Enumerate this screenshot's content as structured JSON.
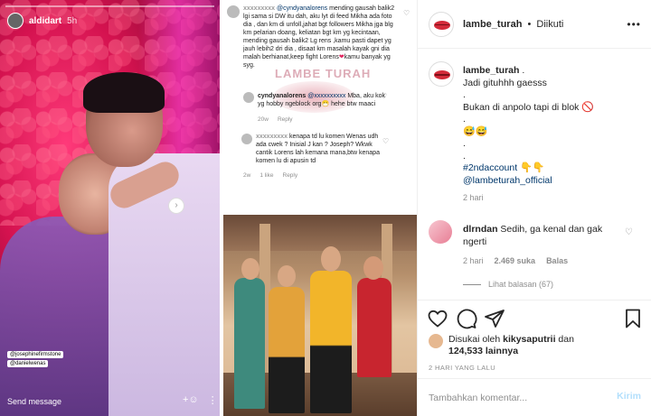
{
  "story": {
    "username": "aldidart",
    "time": "5h",
    "tags": [
      "@josephinefirmstone",
      "@danielwenas"
    ],
    "send_message": "Send message"
  },
  "screenshot": {
    "comment1_user": "@cyndyanalorens",
    "comment1_text": "mending gausah balik2 lgi sama si DW itu dah, aku lyt di feed Mikha ada foto dia , dan km di unfoll,jahat bgt followers Mikha jga blg km pelarian doang, keliatan bgt km yg kecintaan, mending gausah balik2 Lg rens ,kamu pasti dapet yg jauh lebih2 dri dia , disaat km masalah kayak gni dia malah berhianat,keep fight Lorens",
    "comment1_tail": "kamu banyak yg syg.",
    "watermark": "LAMBE TURAH",
    "comment2_user": "cyndyanalorens",
    "comment2_text": "Mba, aku kok yg hobby ngeblock org",
    "comment2_tail": "hehe btw maaci",
    "comment2_meta": [
      "20w",
      "Reply"
    ],
    "comment3_text": "kenapa td lu komen Wenas udh ada cwek ? Inisial J kan ? Joseph? Wkwk cantik Lorens lah kemana mana,btw kenapa komen lu di apusin td",
    "comment3_meta": [
      "2w",
      "1 like",
      "Reply"
    ]
  },
  "header": {
    "username": "lambe_turah",
    "separator": "•",
    "follow_status": "Diikuti",
    "more_icon": "more-icon"
  },
  "caption": {
    "username": "lambe_turah",
    "lines": [
      "Jadi gituhhh gaesss",
      ".",
      "Bukan di anpolo tapi di blok",
      ".",
      "",
      ".",
      "."
    ],
    "hashtag": "#2ndaccount",
    "mention": "@lambeturah_official",
    "time": "2 hari"
  },
  "comment": {
    "username": "dlrndan",
    "text": "Sedih, ga kenal dan gak ngerti",
    "time": "2 hari",
    "likes": "2.469 suka",
    "reply": "Balas",
    "view_replies": "Lihat balasan (67)"
  },
  "likes": {
    "prefix": "Disukai oleh",
    "user": "kikysaputrii",
    "and": "dan",
    "count": "124,533 lainnya"
  },
  "date": "2 HARI YANG LALU",
  "add_comment": {
    "placeholder": "Tambahkan komentar...",
    "button": "Kirim"
  },
  "colors": {
    "accent_blue": "#00376b",
    "button_disabled": "#b2dffc",
    "meta_gray": "#8e8e8e"
  }
}
